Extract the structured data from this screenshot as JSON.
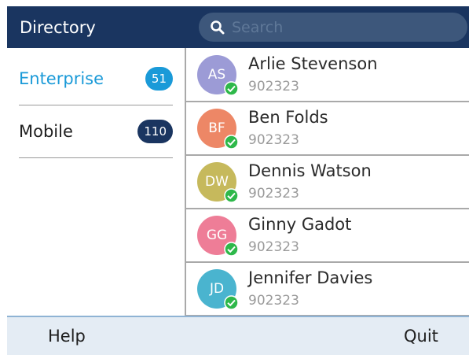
{
  "header": {
    "title": "Directory"
  },
  "search": {
    "placeholder": "Search"
  },
  "sidebar": {
    "items": [
      {
        "label": "Enterprise",
        "count": "51",
        "active": true,
        "badge_color": "#1a9ad8"
      },
      {
        "label": "Mobile",
        "count": "110",
        "active": false,
        "badge_color": "#1a3560"
      }
    ]
  },
  "contacts": [
    {
      "initials": "AS",
      "name": "Arlie Stevenson",
      "number": "902323",
      "color": "#9c9bd6"
    },
    {
      "initials": "BF",
      "name": "Ben Folds",
      "number": "902323",
      "color": "#ed8766"
    },
    {
      "initials": "DW",
      "name": "Dennis Watson",
      "number": "902323",
      "color": "#c6b95c"
    },
    {
      "initials": "GG",
      "name": "Ginny Gadot",
      "number": "902323",
      "color": "#ee7d97"
    },
    {
      "initials": "JD",
      "name": "Jennifer Davies",
      "number": "902323",
      "color": "#4ab4cf"
    }
  ],
  "footer": {
    "help_label": "Help",
    "quit_label": "Quit"
  },
  "icons": {
    "search": "search-icon",
    "status": "online-check-icon"
  },
  "colors": {
    "status_green": "#2eb84a"
  }
}
